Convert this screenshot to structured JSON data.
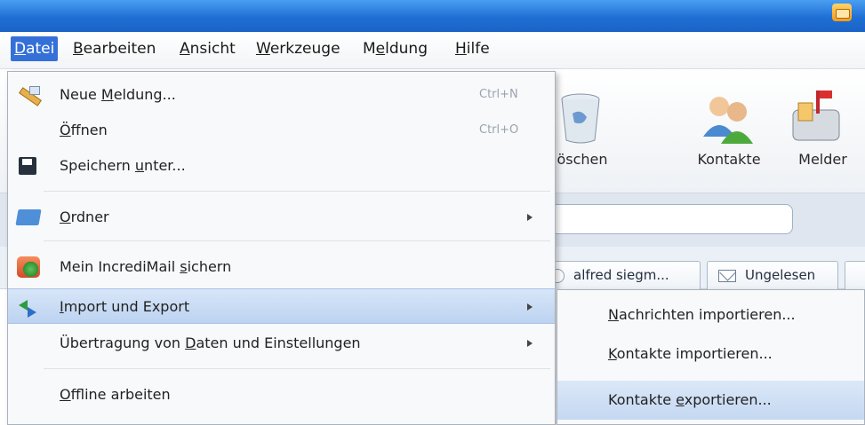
{
  "menubar": {
    "items": [
      {
        "label": "Datei",
        "underline": "D",
        "active": true
      },
      {
        "label": "Bearbeiten",
        "underline": "B"
      },
      {
        "label": "Ansicht",
        "underline": "A"
      },
      {
        "label": "Werkzeuge",
        "underline": "W"
      },
      {
        "label": "Meldung",
        "underline": "e"
      },
      {
        "label": "Hilfe",
        "underline": "H"
      }
    ]
  },
  "toolbar": {
    "delete_label": "öschen",
    "contacts_label": "Kontakte",
    "notifier_label": "Melder"
  },
  "tabs": {
    "chip1": "alfred siegm...",
    "chip2": "Ungelesen"
  },
  "file_menu": {
    "new_message": {
      "pre": "Neue ",
      "ul": "M",
      "post": "eldung...",
      "shortcut": "Ctrl+N",
      "icon": "pencil-icon"
    },
    "open": {
      "pre": "",
      "ul": "Ö",
      "post": "ffnen",
      "shortcut": "Ctrl+O"
    },
    "save_as": {
      "pre": "Speichern ",
      "ul": "u",
      "post": "nter...",
      "icon": "floppy-icon"
    },
    "folder": {
      "pre": "",
      "ul": "O",
      "post": "rdner",
      "icon": "folder-icon"
    },
    "backup": {
      "pre": "Mein IncrediMail ",
      "ul": "s",
      "post": "ichern",
      "icon": "backup-icon"
    },
    "import_export": {
      "pre": "",
      "ul": "I",
      "post": "mport und Export",
      "icon": "import-export-icon"
    },
    "transfer": {
      "pre": "Übertragung von ",
      "ul": "D",
      "post": "aten und Einstellungen"
    },
    "offline": {
      "pre": "",
      "ul": "O",
      "post": "ffline arbeiten"
    }
  },
  "submenu": {
    "import_messages": {
      "pre": "",
      "ul": "N",
      "post": "achrichten importieren..."
    },
    "import_contacts": {
      "pre": "",
      "ul": "K",
      "post": "ontakte importieren..."
    },
    "export_contacts": {
      "pre": "Kontakte ",
      "ul": "e",
      "post": "xportieren..."
    }
  },
  "colors": {
    "titlebar": "#1f6fd4",
    "menu_active": "#3470d8",
    "highlight": "#c4d8f1"
  }
}
